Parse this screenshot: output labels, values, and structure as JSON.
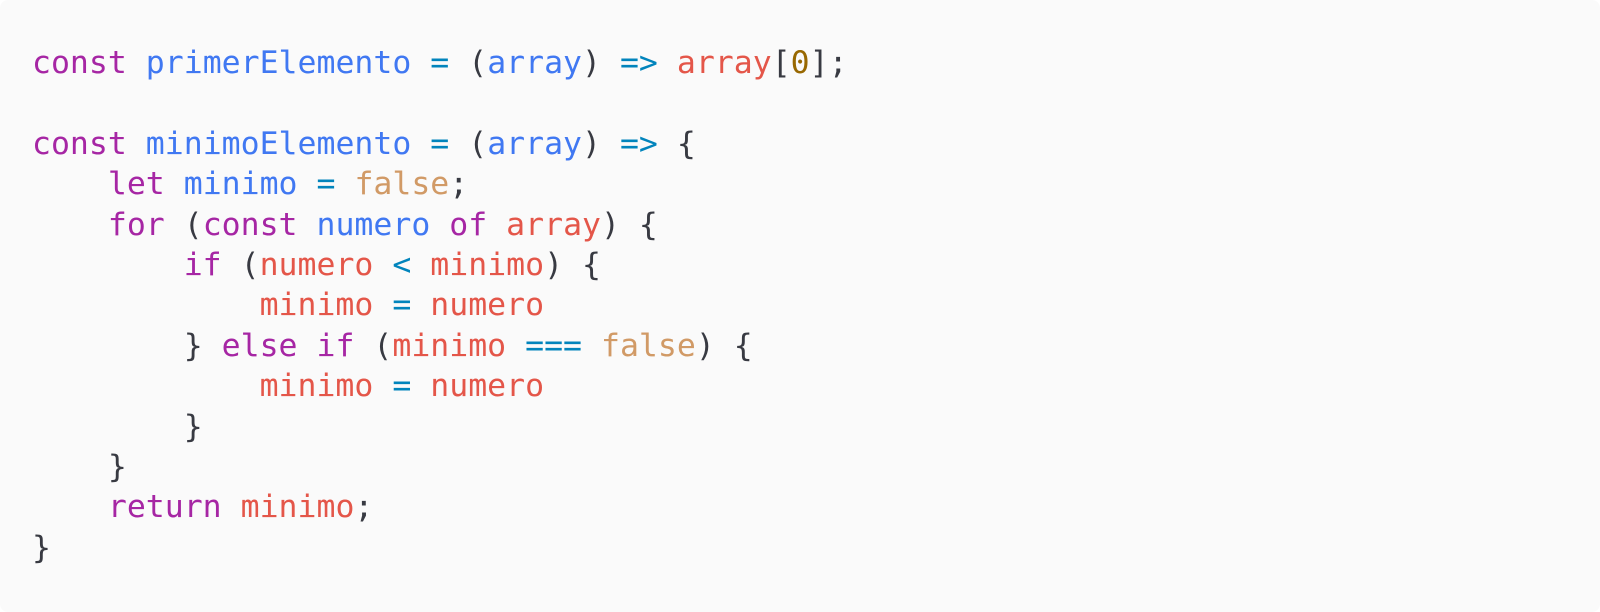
{
  "colors": {
    "background": "#fafafa",
    "text": "#383a42",
    "keyword": "#a626a4",
    "function_name": "#4078f2",
    "operator": "#0184bc",
    "variable": "#e45649",
    "number": "#986801",
    "boolean": "#c18401"
  },
  "code_lines": [
    [
      {
        "t": "const",
        "c": "#a626a4"
      },
      {
        "t": " ",
        "c": "#383a42"
      },
      {
        "t": "primerElemento",
        "c": "#4078f2"
      },
      {
        "t": " ",
        "c": "#383a42"
      },
      {
        "t": "=",
        "c": "#0184bc"
      },
      {
        "t": " (",
        "c": "#383a42"
      },
      {
        "t": "array",
        "c": "#4078f2"
      },
      {
        "t": ") ",
        "c": "#383a42"
      },
      {
        "t": "=>",
        "c": "#0184bc"
      },
      {
        "t": " ",
        "c": "#383a42"
      },
      {
        "t": "array",
        "c": "#e45649"
      },
      {
        "t": "[",
        "c": "#383a42"
      },
      {
        "t": "0",
        "c": "#986801"
      },
      {
        "t": "];",
        "c": "#383a42"
      }
    ],
    [],
    [
      {
        "t": "const",
        "c": "#a626a4"
      },
      {
        "t": " ",
        "c": "#383a42"
      },
      {
        "t": "minimoElemento",
        "c": "#4078f2"
      },
      {
        "t": " ",
        "c": "#383a42"
      },
      {
        "t": "=",
        "c": "#0184bc"
      },
      {
        "t": " (",
        "c": "#383a42"
      },
      {
        "t": "array",
        "c": "#4078f2"
      },
      {
        "t": ") ",
        "c": "#383a42"
      },
      {
        "t": "=>",
        "c": "#0184bc"
      },
      {
        "t": " {",
        "c": "#383a42"
      }
    ],
    [
      {
        "t": "    ",
        "c": "#383a42"
      },
      {
        "t": "let",
        "c": "#a626a4"
      },
      {
        "t": " ",
        "c": "#383a42"
      },
      {
        "t": "minimo",
        "c": "#4078f2"
      },
      {
        "t": " ",
        "c": "#383a42"
      },
      {
        "t": "=",
        "c": "#0184bc"
      },
      {
        "t": " ",
        "c": "#383a42"
      },
      {
        "t": "false",
        "c": "#d19a66"
      },
      {
        "t": ";",
        "c": "#383a42"
      }
    ],
    [
      {
        "t": "    ",
        "c": "#383a42"
      },
      {
        "t": "for",
        "c": "#a626a4"
      },
      {
        "t": " (",
        "c": "#383a42"
      },
      {
        "t": "const",
        "c": "#a626a4"
      },
      {
        "t": " ",
        "c": "#383a42"
      },
      {
        "t": "numero",
        "c": "#4078f2"
      },
      {
        "t": " ",
        "c": "#383a42"
      },
      {
        "t": "of",
        "c": "#a626a4"
      },
      {
        "t": " ",
        "c": "#383a42"
      },
      {
        "t": "array",
        "c": "#e45649"
      },
      {
        "t": ") {",
        "c": "#383a42"
      }
    ],
    [
      {
        "t": "        ",
        "c": "#383a42"
      },
      {
        "t": "if",
        "c": "#a626a4"
      },
      {
        "t": " (",
        "c": "#383a42"
      },
      {
        "t": "numero",
        "c": "#e45649"
      },
      {
        "t": " ",
        "c": "#383a42"
      },
      {
        "t": "<",
        "c": "#0184bc"
      },
      {
        "t": " ",
        "c": "#383a42"
      },
      {
        "t": "minimo",
        "c": "#e45649"
      },
      {
        "t": ") {",
        "c": "#383a42"
      }
    ],
    [
      {
        "t": "            ",
        "c": "#383a42"
      },
      {
        "t": "minimo",
        "c": "#e45649"
      },
      {
        "t": " ",
        "c": "#383a42"
      },
      {
        "t": "=",
        "c": "#0184bc"
      },
      {
        "t": " ",
        "c": "#383a42"
      },
      {
        "t": "numero",
        "c": "#e45649"
      }
    ],
    [
      {
        "t": "        } ",
        "c": "#383a42"
      },
      {
        "t": "else",
        "c": "#a626a4"
      },
      {
        "t": " ",
        "c": "#383a42"
      },
      {
        "t": "if",
        "c": "#a626a4"
      },
      {
        "t": " (",
        "c": "#383a42"
      },
      {
        "t": "minimo",
        "c": "#e45649"
      },
      {
        "t": " ",
        "c": "#383a42"
      },
      {
        "t": "===",
        "c": "#0184bc"
      },
      {
        "t": " ",
        "c": "#383a42"
      },
      {
        "t": "false",
        "c": "#d19a66"
      },
      {
        "t": ") {",
        "c": "#383a42"
      }
    ],
    [
      {
        "t": "            ",
        "c": "#383a42"
      },
      {
        "t": "minimo",
        "c": "#e45649"
      },
      {
        "t": " ",
        "c": "#383a42"
      },
      {
        "t": "=",
        "c": "#0184bc"
      },
      {
        "t": " ",
        "c": "#383a42"
      },
      {
        "t": "numero",
        "c": "#e45649"
      }
    ],
    [
      {
        "t": "        }",
        "c": "#383a42"
      }
    ],
    [
      {
        "t": "    }",
        "c": "#383a42"
      }
    ],
    [
      {
        "t": "    ",
        "c": "#383a42"
      },
      {
        "t": "return",
        "c": "#a626a4"
      },
      {
        "t": " ",
        "c": "#383a42"
      },
      {
        "t": "minimo",
        "c": "#e45649"
      },
      {
        "t": ";",
        "c": "#383a42"
      }
    ],
    [
      {
        "t": "}",
        "c": "#383a42"
      }
    ]
  ]
}
